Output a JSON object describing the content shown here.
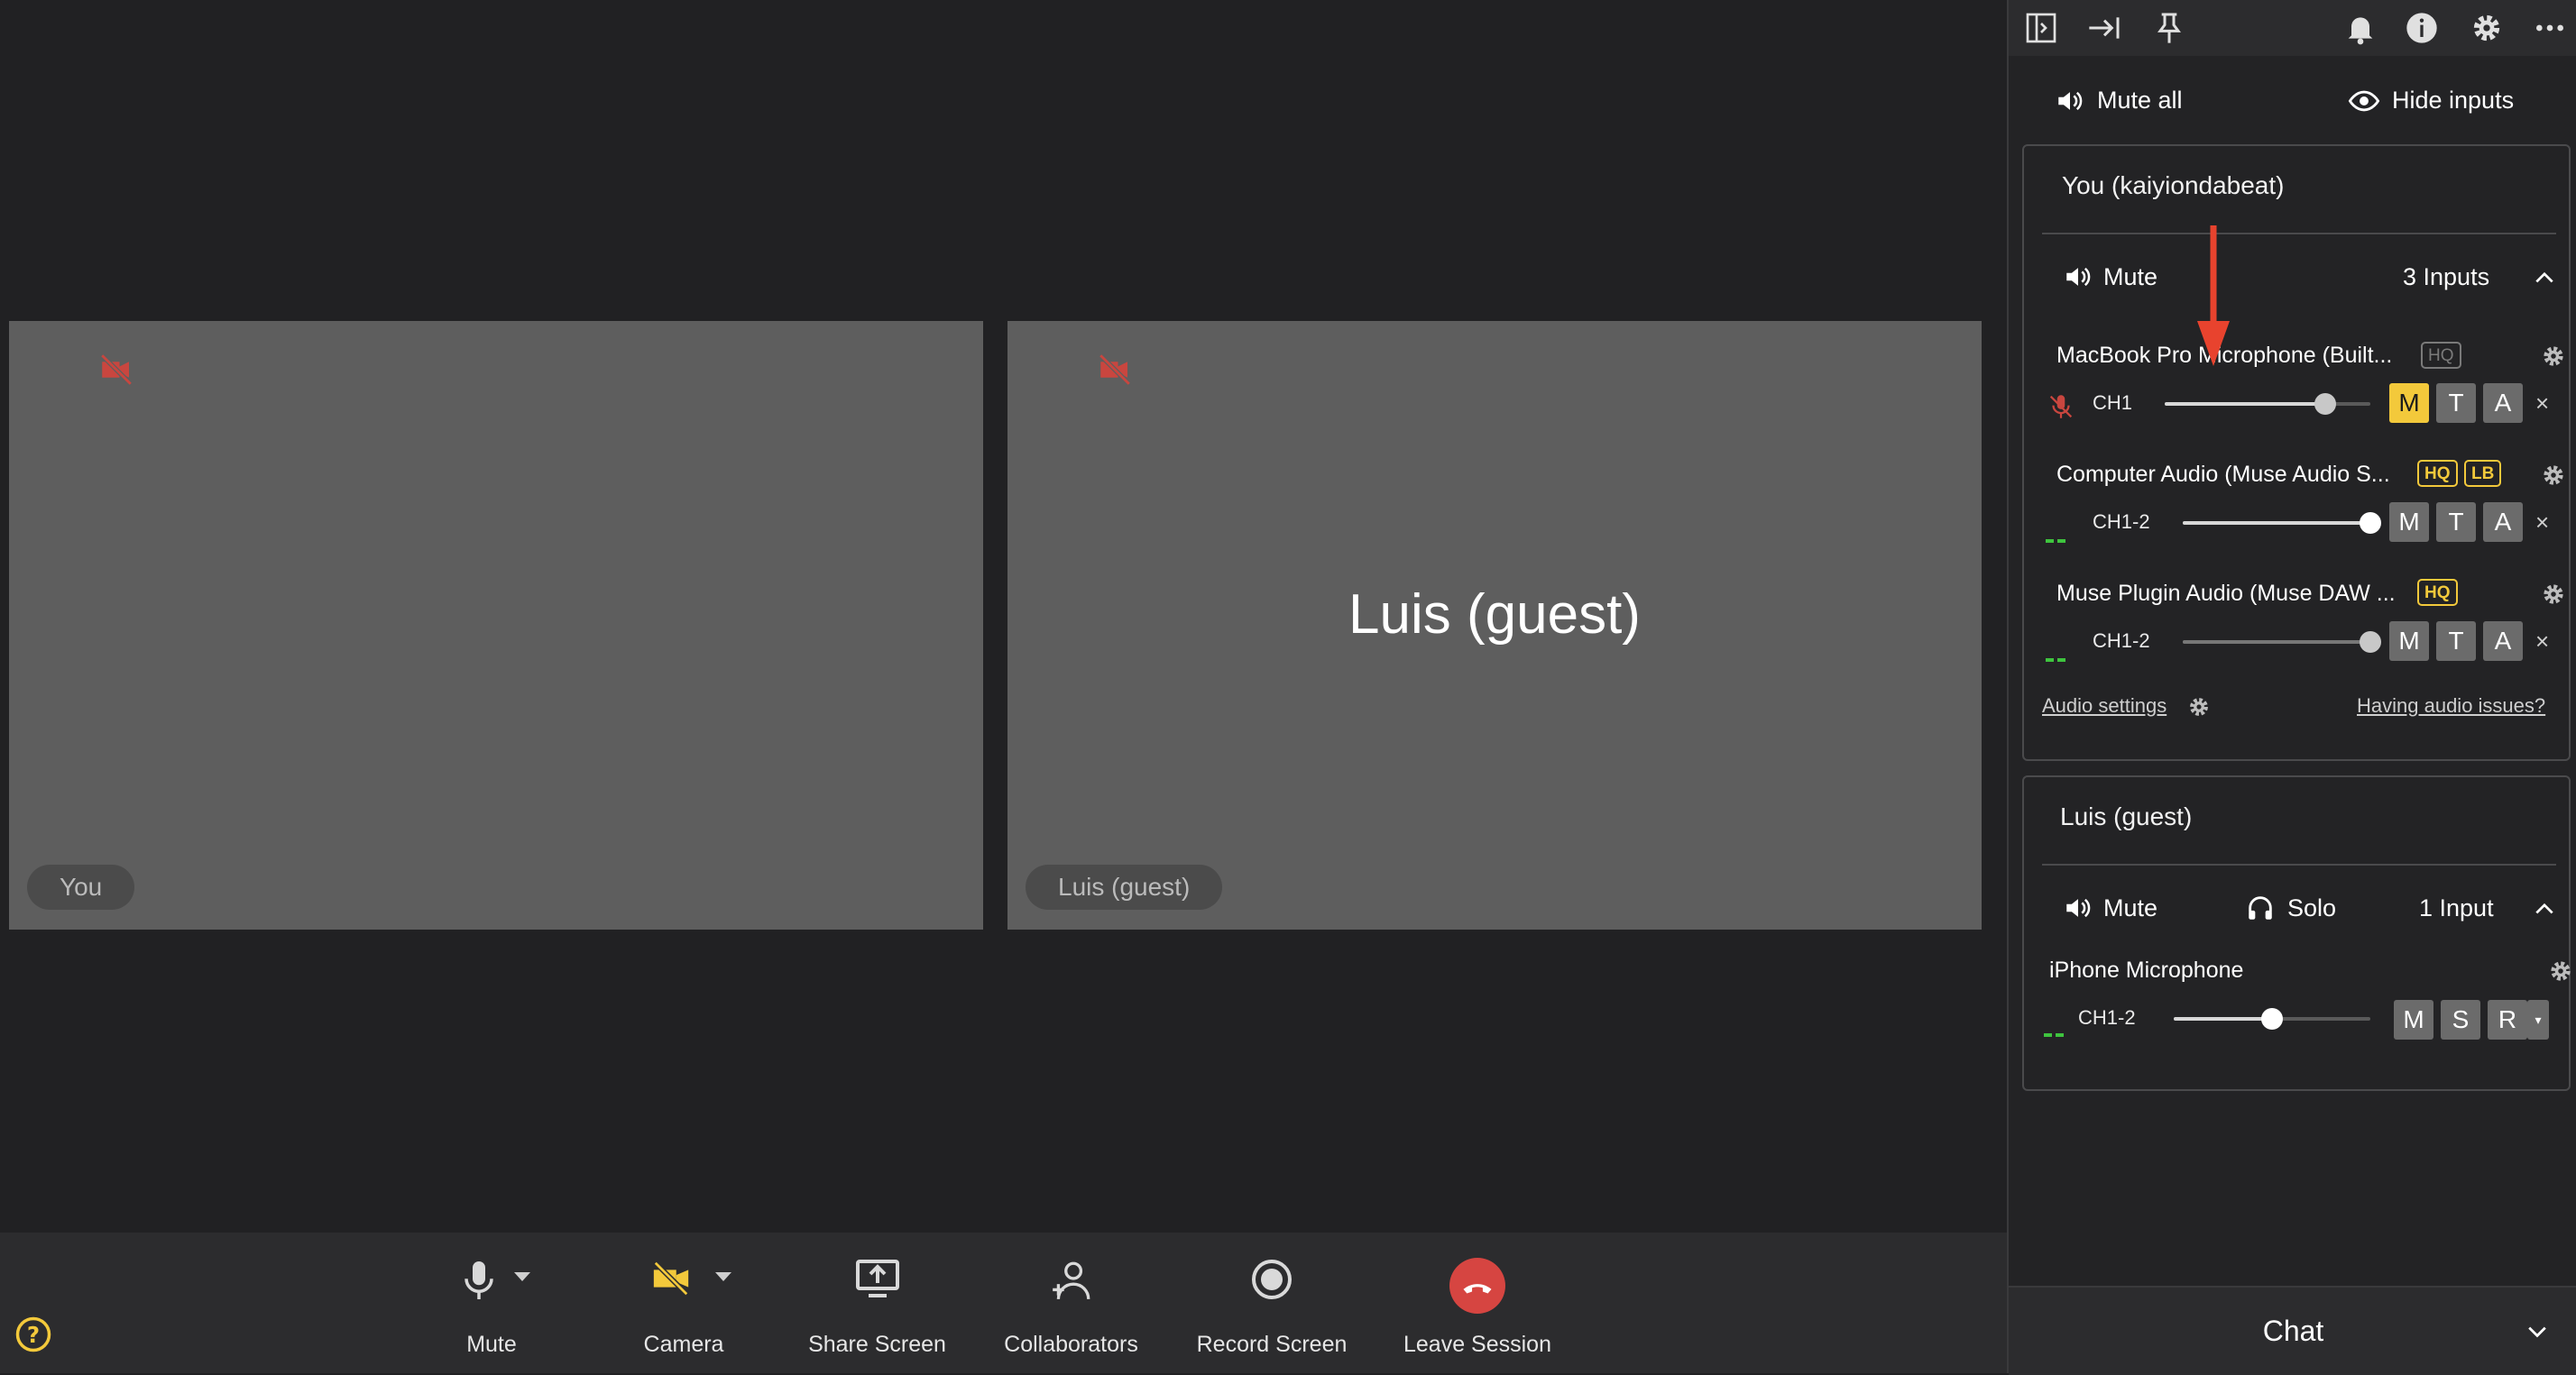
{
  "tiles": {
    "you": {
      "tag": "You"
    },
    "luis": {
      "name": "Luis (guest)",
      "tag": "Luis (guest)"
    }
  },
  "toolbar": {
    "mute": "Mute",
    "camera": "Camera",
    "share": "Share Screen",
    "collaborators": "Collaborators",
    "record": "Record Screen",
    "leave": "Leave Session"
  },
  "panel": {
    "mute_all": "Mute all",
    "hide_inputs": "Hide inputs",
    "you_card": {
      "title": "You (kaiyiondabeat)",
      "mute": "Mute",
      "inputs_count": "3 Inputs",
      "devices": [
        {
          "name": "MacBook Pro Microphone (Built...",
          "channel": "CH1",
          "badges": [
            "HQ"
          ],
          "level": 0.78,
          "m": "M",
          "t": "T",
          "a": "A"
        },
        {
          "name": "Computer Audio (Muse Audio S...",
          "channel": "CH1-2",
          "badges": [
            "HQ",
            "LB"
          ],
          "level": 1.0,
          "m": "M",
          "t": "T",
          "a": "A"
        },
        {
          "name": "Muse Plugin Audio (Muse DAW ...",
          "channel": "CH1-2",
          "badges": [
            "HQ"
          ],
          "level": 1.0,
          "m": "M",
          "t": "T",
          "a": "A"
        }
      ],
      "audio_settings": "Audio settings",
      "audio_issues": "Having audio issues?"
    },
    "guest_card": {
      "title": "Luis (guest)",
      "mute": "Mute",
      "solo": "Solo",
      "inputs_count": "1 Input",
      "device": {
        "name": "iPhone Microphone",
        "channel": "CH1-2",
        "level": 0.5,
        "m": "M",
        "s": "S",
        "r": "R"
      }
    },
    "chat": "Chat"
  },
  "colors": {
    "accent": "#f3c93b",
    "danger": "#d64541",
    "annotation_arrow": "#e8432e"
  }
}
